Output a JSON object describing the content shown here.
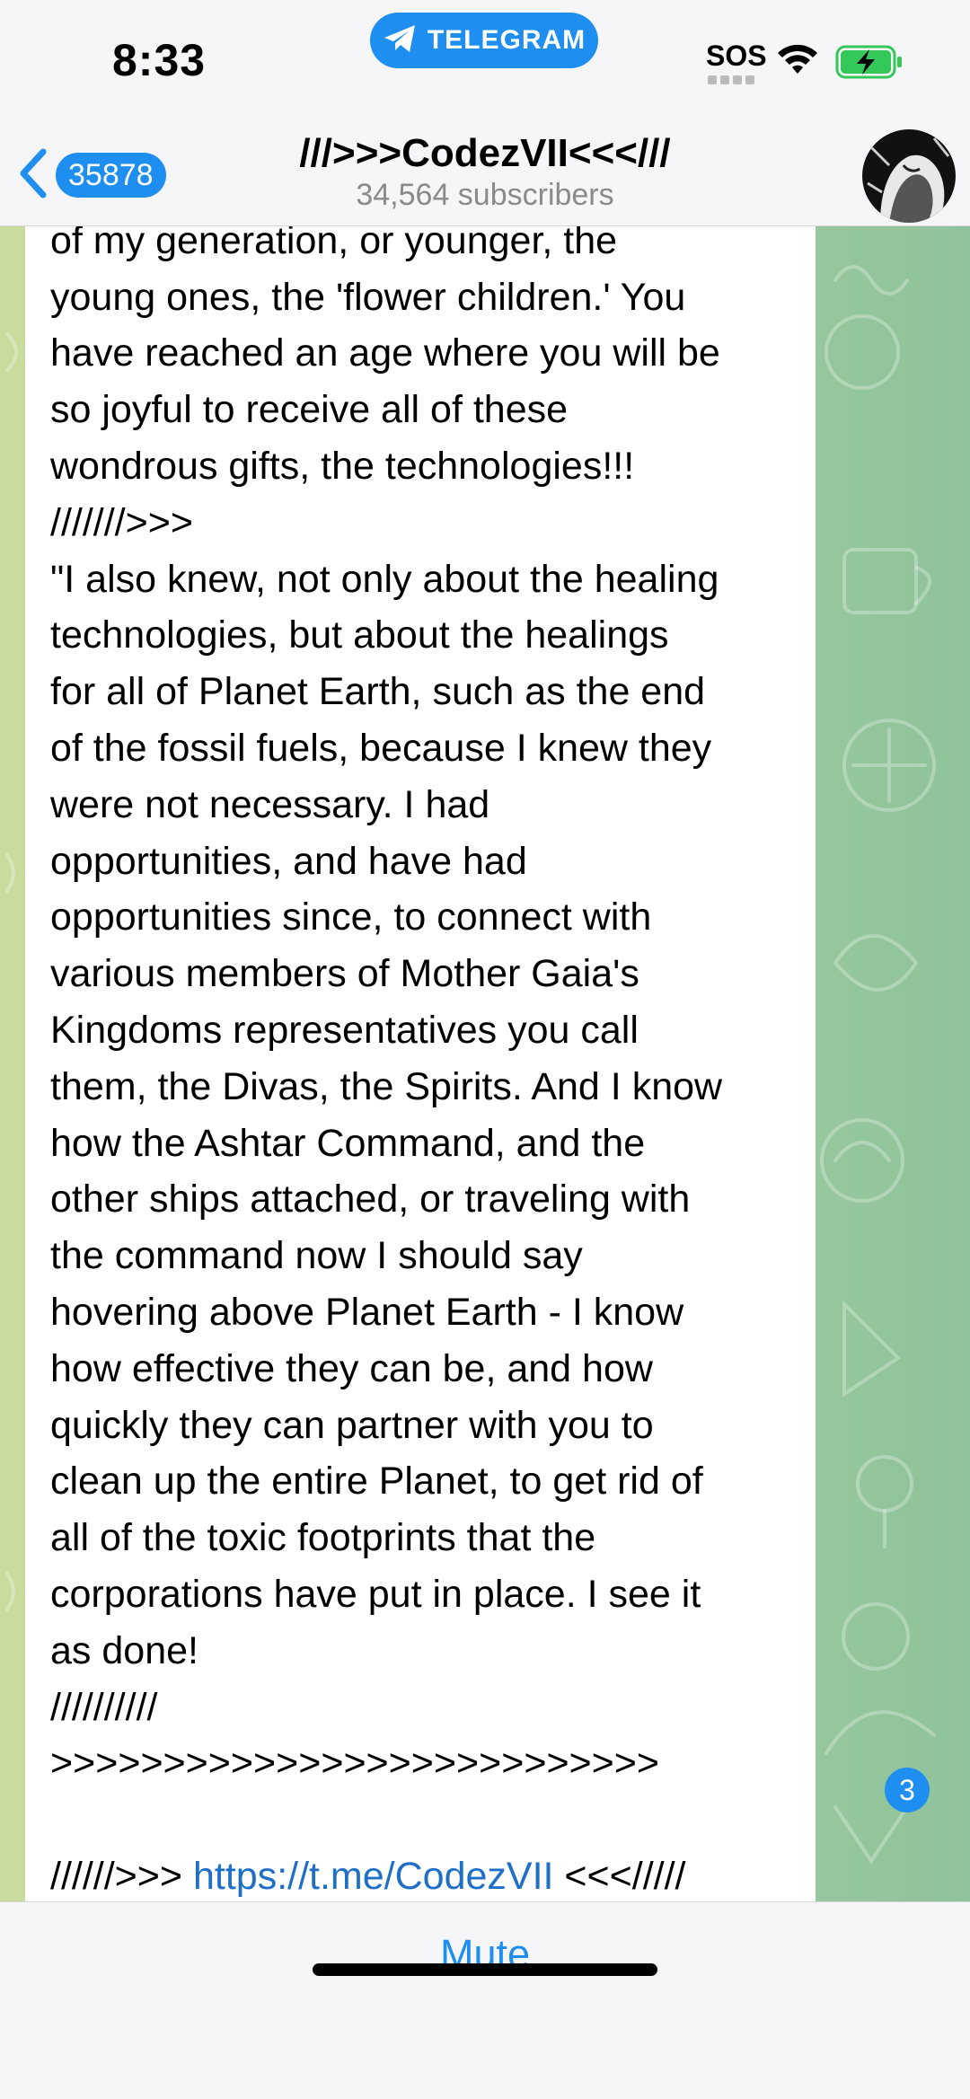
{
  "status_bar": {
    "time": "8:33",
    "return_pill": "TELEGRAM",
    "sos": "SOS"
  },
  "header": {
    "back_count": "35878",
    "title": "///>>>CodezVII<<</// ",
    "subtitle": "34,564 subscribers"
  },
  "message": {
    "lines": [
      "of my generation, or younger, the",
      "young ones, the 'flower children.' You",
      "have reached an age where you will be",
      "so joyful to receive all of these",
      "wondrous gifts, the technologies!!!",
      "///////>>>",
      "\"I also knew, not only about the healing",
      "technologies, but about the healings",
      "for all of Planet Earth, such as the end",
      "of the fossil fuels, because I knew they",
      "were not necessary. I had",
      "opportunities, and have had",
      "opportunities since, to connect with",
      "various members of Mother Gaia's",
      "Kingdoms representatives you call",
      "them, the Divas, the Spirits. And I know",
      "how the Ashtar Command, and the",
      "other ships attached, or traveling with",
      "the command now I should say",
      "hovering above Planet Earth - I know",
      "how effective they can be, and how",
      "quickly they can partner with you to",
      "clean up the entire Planet, to get rid of",
      "all of the toxic footprints that the",
      "corporations have put in place. I see it",
      "as done!",
      "//////////",
      ">>>>>>>>>>>>>>>>>>>>>>>>>>>"
    ],
    "link_line": {
      "prefix": "//////>>> ",
      "link": "https://t.me/CodezVII",
      "suffix": " <<</////"
    },
    "last_line": "//////////"
  },
  "scroll": {
    "unread": "3"
  },
  "bottom_bar": {
    "mute_label": "Mute"
  },
  "colors": {
    "accent": "#1e8ef0",
    "link": "#1f6fc7",
    "battery": "#34c759"
  }
}
